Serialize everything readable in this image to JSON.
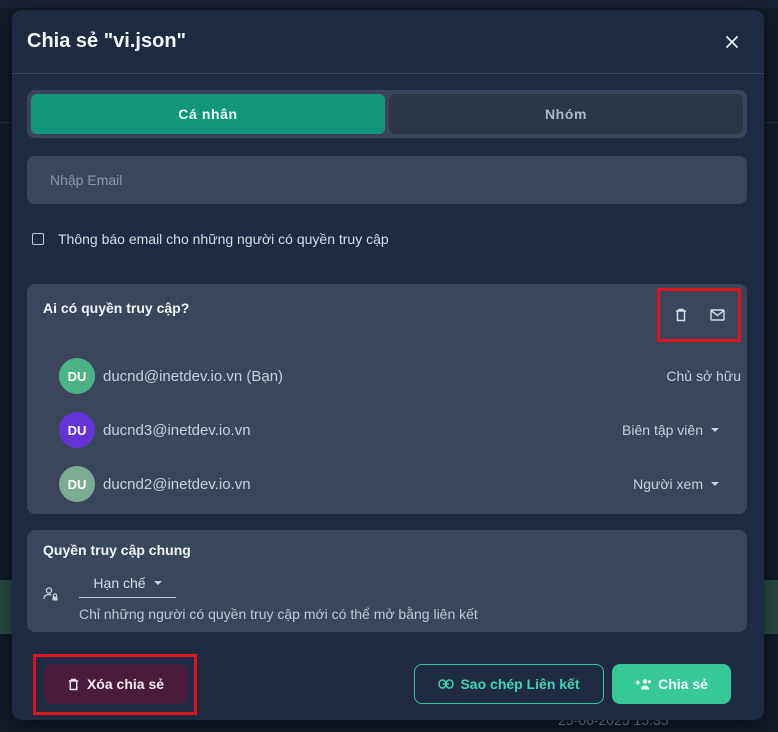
{
  "dialog": {
    "title": "Chia sẻ \"vi.json\""
  },
  "tabs": [
    {
      "label": "Cá nhân",
      "active": true
    },
    {
      "label": "Nhóm",
      "active": false
    }
  ],
  "email_input": {
    "placeholder": "Nhập Email",
    "value": ""
  },
  "notify": {
    "label": "Thông báo email cho những người có quyền truy cập",
    "checked": false
  },
  "access": {
    "title": "Ai có quyền truy cập?",
    "actions": [
      {
        "icon": "trash-icon"
      },
      {
        "icon": "mail-icon"
      }
    ],
    "members": [
      {
        "initials": "DU",
        "email": "ducnd@inetdev.io.vn (Bạn)",
        "role": "Chủ sở hữu",
        "avatar_color": "#4cb387",
        "has_dropdown": false
      },
      {
        "initials": "DU",
        "email": "ducnd3@inetdev.io.vn",
        "role": "Biên tập viên",
        "avatar_color": "#6434d8",
        "has_dropdown": true
      },
      {
        "initials": "DU",
        "email": "ducnd2@inetdev.io.vn",
        "role": "Người xem",
        "avatar_color": "#7cab94",
        "has_dropdown": true
      }
    ]
  },
  "general_access": {
    "title": "Quyền truy cập chung",
    "icon": "person-lock-icon",
    "selected": "Hạn chế",
    "description": "Chỉ những người có quyền truy cập mới có thể mở bằng liên kết"
  },
  "footer": {
    "delete_label": "Xóa chia sẻ",
    "copy_label": "Sao chép Liên kết",
    "share_label": "Chia sẻ"
  },
  "background": {
    "date_text": "25-06-2025 15:35"
  },
  "colors": {
    "accent": "#11967a",
    "share": "#36c995",
    "danger_bg": "#4a1b3a",
    "highlight": "#e0141c"
  }
}
